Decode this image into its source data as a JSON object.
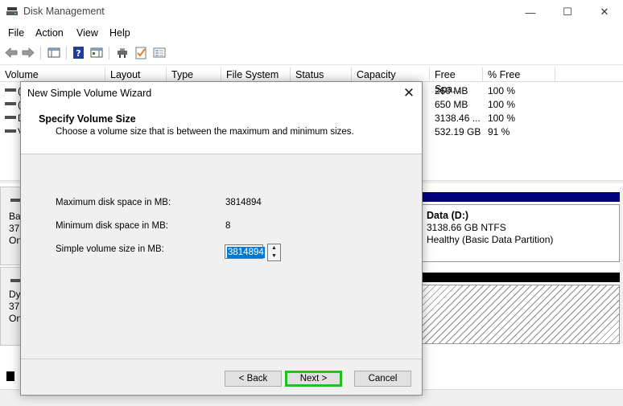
{
  "window": {
    "title": "Disk Management",
    "minimize": "—",
    "maximize": "☐",
    "close": "✕"
  },
  "menu": [
    "File",
    "Action",
    "View",
    "Help"
  ],
  "volume_list": {
    "columns": [
      "Volume",
      "Layout",
      "Type",
      "File System",
      "Status",
      "Capacity",
      "Free Spa...",
      "% Free"
    ],
    "rows": [
      {
        "vol": "(",
        "free": "260 MB",
        "pct": "100 %"
      },
      {
        "vol": "(",
        "free": "650 MB",
        "pct": "100 %"
      },
      {
        "vol": "D",
        "free": "3138.46 ...",
        "pct": "100 %"
      },
      {
        "vol": "V",
        "free": "532.19 GB",
        "pct": "91 %"
      }
    ]
  },
  "disk_left": {
    "disk1": [
      "Ba",
      "372",
      "On"
    ],
    "disk2": [
      "Dy",
      "372",
      "On"
    ]
  },
  "partition": {
    "name": "Data  (D:)",
    "size": "3138.66 GB NTFS",
    "status": "Healthy (Basic Data Partition)"
  },
  "colors": {
    "primary_bar": "#00007f",
    "unalloc_bar": "#000000",
    "highlight": "#21c020",
    "selection": "#0078d7"
  },
  "dialog": {
    "title": "New Simple Volume Wizard",
    "close": "✕",
    "heading": "Specify Volume Size",
    "subheading": "Choose a volume size that is between the maximum and minimum sizes.",
    "fields": {
      "max_label": "Maximum disk space in MB:",
      "max_value": "3814894",
      "min_label": "Minimum disk space in MB:",
      "min_value": "8",
      "size_label": "Simple volume size in MB:",
      "size_value": "3814894"
    },
    "buttons": {
      "back": "< Back",
      "next": "Next >",
      "cancel": "Cancel"
    }
  }
}
